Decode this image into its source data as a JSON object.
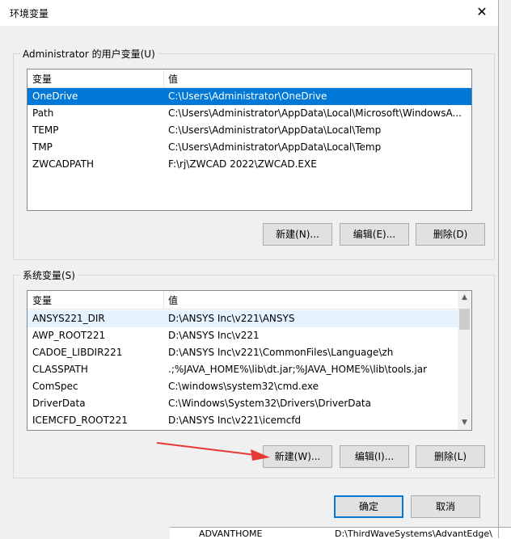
{
  "window": {
    "title": "环境变量",
    "close_glyph": "✕"
  },
  "user_group": {
    "legend": "Administrator 的用户变量(U)",
    "columns": [
      "变量",
      "值"
    ],
    "rows": [
      {
        "name": "OneDrive",
        "value": "C:\\Users\\Administrator\\OneDrive"
      },
      {
        "name": "Path",
        "value": "C:\\Users\\Administrator\\AppData\\Local\\Microsoft\\WindowsA..."
      },
      {
        "name": "TEMP",
        "value": "C:\\Users\\Administrator\\AppData\\Local\\Temp"
      },
      {
        "name": "TMP",
        "value": "C:\\Users\\Administrator\\AppData\\Local\\Temp"
      },
      {
        "name": "ZWCADPATH",
        "value": "F:\\rj\\ZWCAD 2022\\ZWCAD.EXE"
      }
    ],
    "selected_index": 0,
    "buttons": {
      "new": "新建(N)...",
      "edit": "编辑(E)...",
      "delete": "删除(D)"
    }
  },
  "system_group": {
    "legend": "系统变量(S)",
    "columns": [
      "变量",
      "值"
    ],
    "rows": [
      {
        "name": "ANSYS221_DIR",
        "value": "D:\\ANSYS Inc\\v221\\ANSYS"
      },
      {
        "name": "AWP_ROOT221",
        "value": "D:\\ANSYS Inc\\v221"
      },
      {
        "name": "CADOE_LIBDIR221",
        "value": "D:\\ANSYS Inc\\v221\\CommonFiles\\Language\\zh"
      },
      {
        "name": "CLASSPATH",
        "value": ".;%JAVA_HOME%\\lib\\dt.jar;%JAVA_HOME%\\lib\\tools.jar"
      },
      {
        "name": "ComSpec",
        "value": "C:\\windows\\system32\\cmd.exe"
      },
      {
        "name": "DriverData",
        "value": "C:\\Windows\\System32\\Drivers\\DriverData"
      },
      {
        "name": "ICEMCFD_ROOT221",
        "value": "D:\\ANSYS Inc\\v221\\icemcfd"
      }
    ],
    "buttons": {
      "new": "新建(W)...",
      "edit": "编辑(I)...",
      "delete": "删除(L)"
    }
  },
  "footer": {
    "ok": "确定",
    "cancel": "取消"
  },
  "background_peek": {
    "left_name": "ADVANTHOME",
    "left_value": "D:\\ThirdWaveSystems\\AdvantEdge\\"
  },
  "colors": {
    "selection": "#0078d7",
    "annotation_arrow": "#e53935"
  }
}
